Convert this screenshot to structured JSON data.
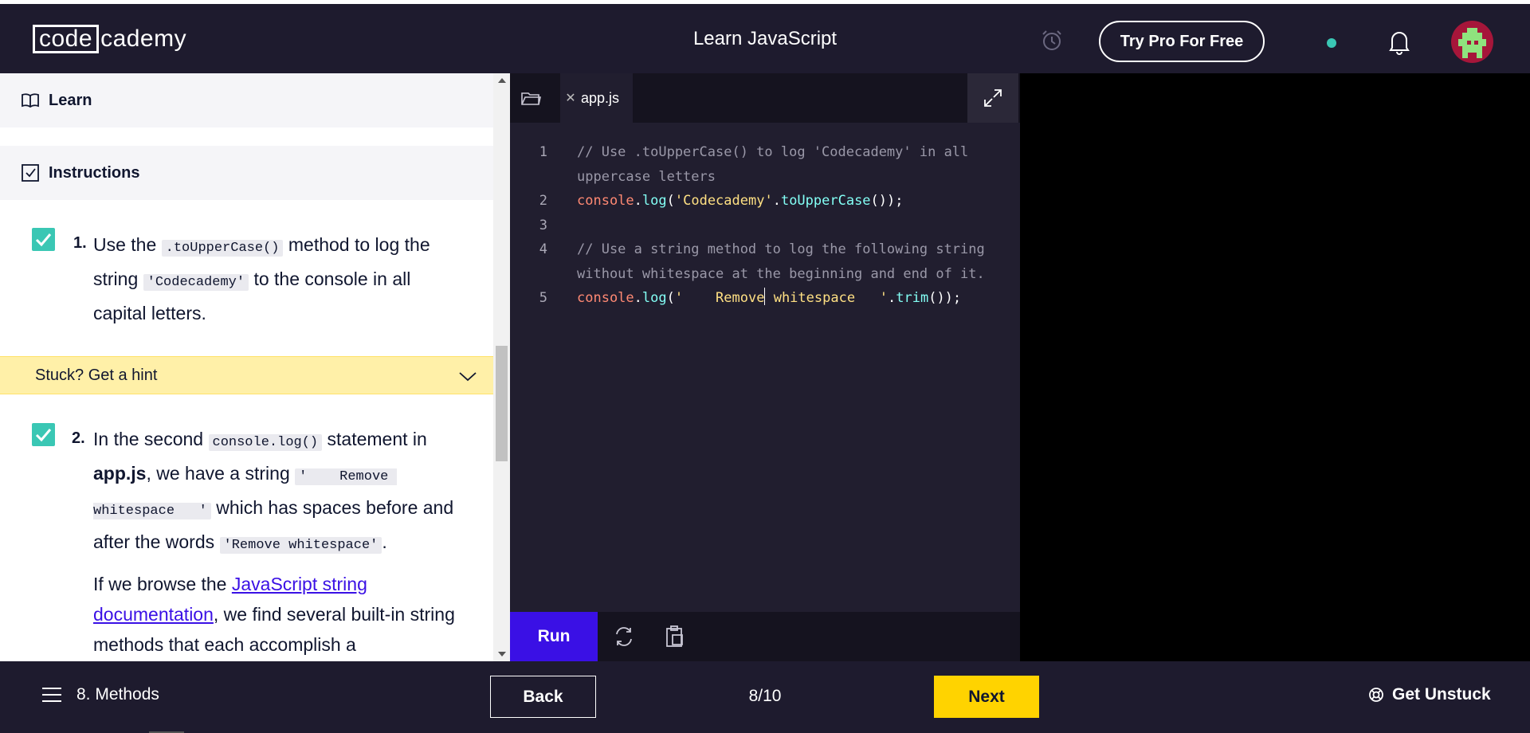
{
  "header": {
    "logo_code": "code",
    "logo_rest": "cademy",
    "title": "Learn JavaScript",
    "pro_button": "Try Pro For Free",
    "alarm_icon": "alarm-clock-icon",
    "bell_icon": "bell-icon",
    "status_color": "#3ac7b4"
  },
  "left_panel": {
    "learn_label": "Learn",
    "instructions_label": "Instructions",
    "task1": {
      "number": "1.",
      "text_before": "Use the ",
      "code1": ".toUpperCase()",
      "text_mid": " method to log the string ",
      "code2": "'Codecademy'",
      "text_after": " to the console in all capital letters.",
      "checked": true
    },
    "hint_label": "Stuck? Get a hint",
    "task2": {
      "number": "2.",
      "text_a": "In the second ",
      "code1": "console.log()",
      "text_b": " statement in ",
      "bold": "app.js",
      "text_c": ", we have a string ",
      "code2": "'    Remove whitespace   '",
      "text_d": " which has spaces before and after the words ",
      "code3": "'Remove whitespace'",
      "text_e": ".",
      "checked": true
    },
    "para": {
      "text_a": "If we browse the ",
      "link": "JavaScript string documentation",
      "text_b": ", we find several built-in string methods that each accomplish a"
    }
  },
  "editor": {
    "tab_name": "app.js",
    "lines": [
      {
        "n": "1",
        "parts": [
          {
            "c": "cm",
            "t": "// Use .toUpperCase() to log 'Codecademy' in all"
          }
        ]
      },
      {
        "n": "",
        "parts": [
          {
            "c": "cm",
            "t": "uppercase letters"
          }
        ]
      },
      {
        "n": "2",
        "parts": [
          {
            "c": "kw",
            "t": "console"
          },
          {
            "c": "",
            "t": "."
          },
          {
            "c": "fn",
            "t": "log"
          },
          {
            "c": "",
            "t": "("
          },
          {
            "c": "st",
            "t": "'Codecademy'"
          },
          {
            "c": "",
            "t": "."
          },
          {
            "c": "fn",
            "t": "toUpperCase"
          },
          {
            "c": "",
            "t": "());"
          }
        ]
      },
      {
        "n": "3",
        "parts": []
      },
      {
        "n": "4",
        "parts": [
          {
            "c": "cm",
            "t": "// Use a string method to log the following string"
          }
        ]
      },
      {
        "n": "",
        "parts": [
          {
            "c": "cm",
            "t": "without whitespace at the beginning and end of it."
          }
        ]
      },
      {
        "n": "5",
        "parts": [
          {
            "c": "kw",
            "t": "console"
          },
          {
            "c": "",
            "t": "."
          },
          {
            "c": "fn",
            "t": "log"
          },
          {
            "c": "",
            "t": "("
          },
          {
            "c": "st",
            "t": "'    Remove"
          },
          {
            "c": "caret",
            "t": ""
          },
          {
            "c": "st",
            "t": " whitespace   '"
          },
          {
            "c": "",
            "t": "."
          },
          {
            "c": "fn",
            "t": "trim"
          },
          {
            "c": "",
            "t": "());"
          }
        ]
      }
    ],
    "run_label": "Run"
  },
  "footer": {
    "lesson_label": "8. Methods",
    "back_label": "Back",
    "progress": "8/10",
    "next_label": "Next",
    "unstuck_label": "Get Unstuck"
  },
  "colors": {
    "accent": "#3a10e5",
    "next": "#ffd300",
    "check": "#3ac7b4",
    "hint_bg": "#fff0a8"
  }
}
